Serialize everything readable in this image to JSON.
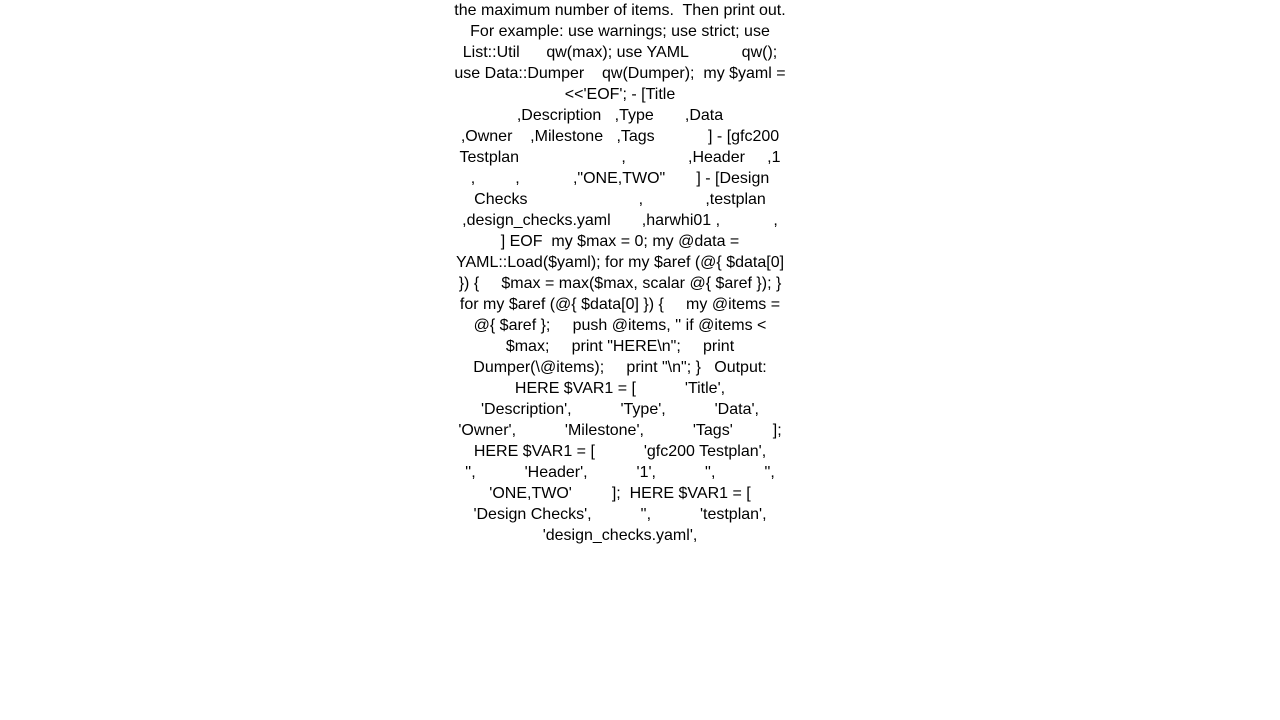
{
  "document": {
    "body_text": "the maximum number of items.  Then print out. For example: use warnings; use strict; use List::Util      qw(max); use YAML            qw(); use Data::Dumper    qw(Dumper);  my $yaml = <<'EOF'; - [Title                                 ,Description   ,Type       ,Data                     ,Owner    ,Milestone   ,Tags            ] - [gfc200 Testplan                       ,              ,Header     ,1                        ,         ,            ,\"ONE,TWO\"       ] - [Design Checks                         ,              ,testplan   ,design_checks.yaml       ,harwhi01 ,            ,                ] EOF  my $max = 0; my @data = YAML::Load($yaml); for my $aref (@{ $data[0] }) {     $max = max($max, scalar @{ $aref }); }  for my $aref (@{ $data[0] }) {     my @items = @{ $aref };     push @items, '' if @items < $max;     print \"HERE\\n\";     print Dumper(\\@items);     print \"\\n\"; }   Output: HERE $VAR1 = [           'Title',           'Description',           'Type',           'Data',           'Owner',           'Milestone',           'Tags'         ];  HERE $VAR1 = [           'gfc200 Testplan',           '',           'Header',           '1',           '',           '',           'ONE,TWO'         ];  HERE $VAR1 = [           'Design Checks',           '',           'testplan',           'design_checks.yaml',"
  }
}
